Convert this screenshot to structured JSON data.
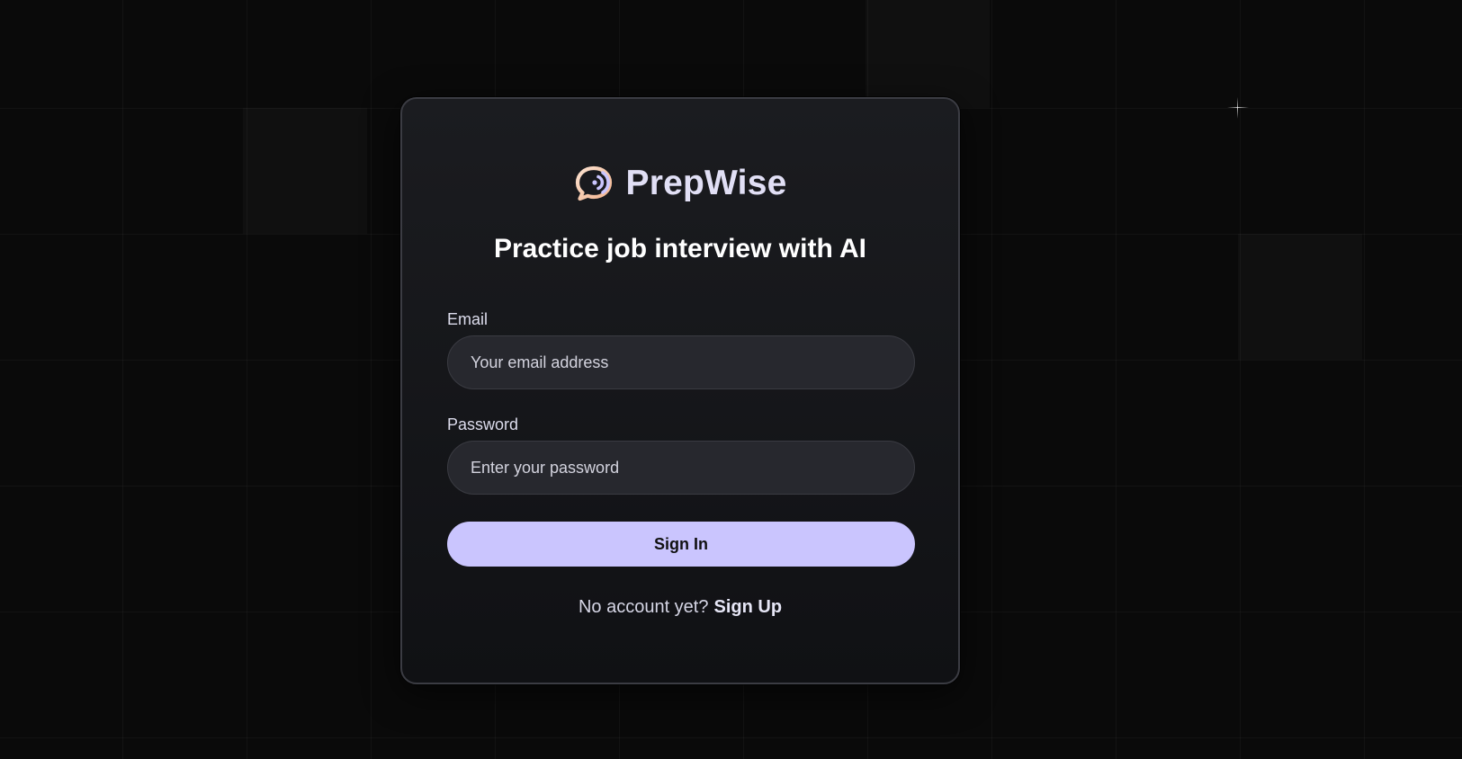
{
  "brand": {
    "name": "PrepWise",
    "icon": "speech-bubble-icon",
    "accent_color": "#cac5fe",
    "icon_color": "#f6c9a9"
  },
  "tagline": "Practice job interview with AI",
  "form": {
    "email": {
      "label": "Email",
      "value": "",
      "placeholder": "Your email address"
    },
    "password": {
      "label": "Password",
      "value": "",
      "placeholder": "Enter your password"
    },
    "submit_label": "Sign In"
  },
  "footer": {
    "prompt": "No account yet?",
    "link_label": "Sign Up"
  }
}
